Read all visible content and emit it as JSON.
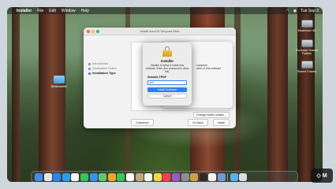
{
  "menubar": {
    "app_name": "Installer",
    "items": [
      "File",
      "Edit",
      "Window",
      "Help"
    ],
    "clock": "Tue Sep 3"
  },
  "desktop": {
    "icons": [
      {
        "label": "Macintosh HD"
      },
      {
        "label": "Purchase Shared Folders"
      },
      {
        "label": "Shared Folders"
      },
      {
        "label": "BetaInstaller"
      }
    ]
  },
  "installer": {
    "title": "Install macOS Sequoia Beta",
    "steps": [
      {
        "label": "Introduction",
        "state": "done"
      },
      {
        "label": "Destination Select",
        "state": "done"
      },
      {
        "label": "Installation Type",
        "state": "current"
      }
    ],
    "content_line1": "computer",
    "content_line2": "ation of this software",
    "change_location_button": "Change Install Location...",
    "customize_button": "Customize",
    "back_button": "Go Back",
    "install_button": "Install"
  },
  "auth_dialog": {
    "title": "Installer",
    "message": "Installer is trying to install new software. Enter your password to allow this.",
    "username": "Seaside TPSP",
    "password_value": "••••",
    "primary_button": "Install Software",
    "cancel_button": "Cancel"
  },
  "dock": {
    "apps": [
      {
        "name": "finder-icon",
        "color": "#3d8ef0"
      },
      {
        "name": "launchpad-icon",
        "color": "#e5e5e5"
      },
      {
        "name": "appstore-icon",
        "color": "#1f8bf5"
      },
      {
        "name": "safari-icon",
        "color": "#2a9df4"
      },
      {
        "name": "chrome-icon",
        "color": "#f4f4f4"
      },
      {
        "name": "messages-icon",
        "color": "#35c759"
      },
      {
        "name": "mail-icon",
        "color": "#3b8ff5"
      },
      {
        "name": "maps-icon",
        "color": "#5fc86a"
      },
      {
        "name": "photos-icon",
        "color": "#f5a623"
      },
      {
        "name": "facetime-icon",
        "color": "#34c759"
      },
      {
        "name": "calendar-icon",
        "color": "#ffffff"
      },
      {
        "name": "contacts-icon",
        "color": "#c8a57a"
      },
      {
        "name": "reminders-icon",
        "color": "#f5f5f5"
      },
      {
        "name": "notes-icon",
        "color": "#f7d74a"
      },
      {
        "name": "music-icon",
        "color": "#fa3e56"
      },
      {
        "name": "podcasts-icon",
        "color": "#9b59d0"
      },
      {
        "name": "settings-icon",
        "color": "#8e8e93"
      },
      {
        "name": "installer-icon",
        "color": "#c9a34a"
      },
      {
        "name": "terminal-icon",
        "color": "#2b2b2b"
      },
      {
        "name": "textedit-icon",
        "color": "#f2f2f2"
      },
      {
        "name": "preview-icon",
        "color": "#6b9bd1"
      },
      {
        "name": "folder-icon",
        "color": "#59b2ec"
      },
      {
        "name": "trash-icon",
        "color": "#d9dde2"
      }
    ]
  },
  "overlay_badge": "M"
}
